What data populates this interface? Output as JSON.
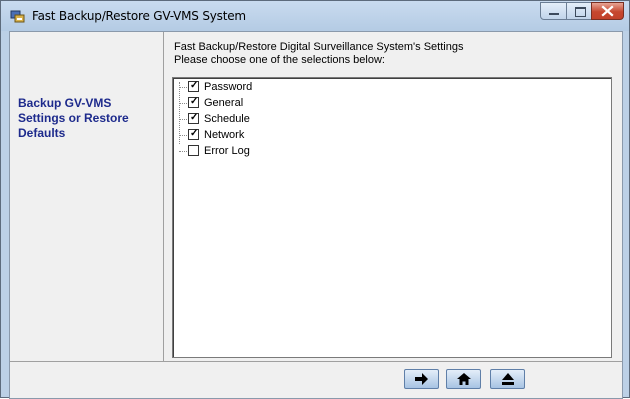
{
  "window": {
    "title": "Fast Backup/Restore GV-VMS System"
  },
  "sidebar": {
    "title": "Backup GV-VMS Settings or Restore Defaults"
  },
  "main": {
    "heading": "Fast Backup/Restore Digital Surveillance System's Settings",
    "prompt": "Please choose one of the selections below:",
    "options": [
      {
        "label": "Password",
        "checked": true
      },
      {
        "label": "General",
        "checked": true
      },
      {
        "label": "Schedule",
        "checked": true
      },
      {
        "label": "Network",
        "checked": true
      },
      {
        "label": "Error Log",
        "checked": false
      }
    ]
  },
  "icons": {
    "app": "backup-app-icon",
    "next": "arrow-right-icon",
    "home": "home-icon",
    "eject": "eject-icon"
  },
  "colors": {
    "sidebar_title": "#1d2a8c",
    "titlebar": "#c9dbef",
    "close_button": "#c6472f"
  }
}
